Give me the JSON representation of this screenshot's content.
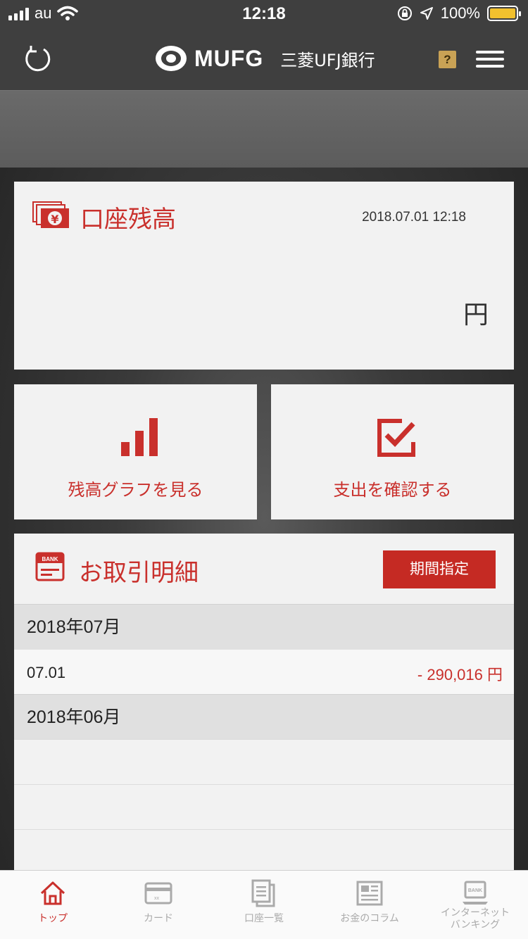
{
  "status_bar": {
    "carrier": "au",
    "time": "12:18",
    "battery": "100%"
  },
  "nav": {
    "brand": "MUFG",
    "bank_name": "三菱UFJ銀行",
    "help_label": "?"
  },
  "balance": {
    "title": "口座残高",
    "date": "2018.07.01 12:18",
    "unit": "円"
  },
  "actions": [
    {
      "label": "残高グラフを見る",
      "icon": "bar-chart-icon"
    },
    {
      "label": "支出を確認する",
      "icon": "checkbox-icon"
    }
  ],
  "transactions": {
    "title": "お取引明細",
    "period_button": "期間指定",
    "months": [
      {
        "label": "2018年07月"
      },
      {
        "label": "2018年06月"
      }
    ],
    "items": [
      {
        "date": "07.01",
        "amount": "- 290,016 円"
      }
    ]
  },
  "tabs": [
    {
      "label": "トップ",
      "icon": "home-icon",
      "active": true
    },
    {
      "label": "カード",
      "icon": "card-icon",
      "active": false
    },
    {
      "label": "口座一覧",
      "icon": "document-stack-icon",
      "active": false
    },
    {
      "label": "お金のコラム",
      "icon": "newspaper-icon",
      "active": false
    },
    {
      "label": "インターネット\nバンキング",
      "icon": "bank-laptop-icon",
      "active": false
    }
  ],
  "colors": {
    "accent": "#c9302c",
    "header": "#3f3f3f",
    "tab_inactive": "#aaaaaa"
  }
}
